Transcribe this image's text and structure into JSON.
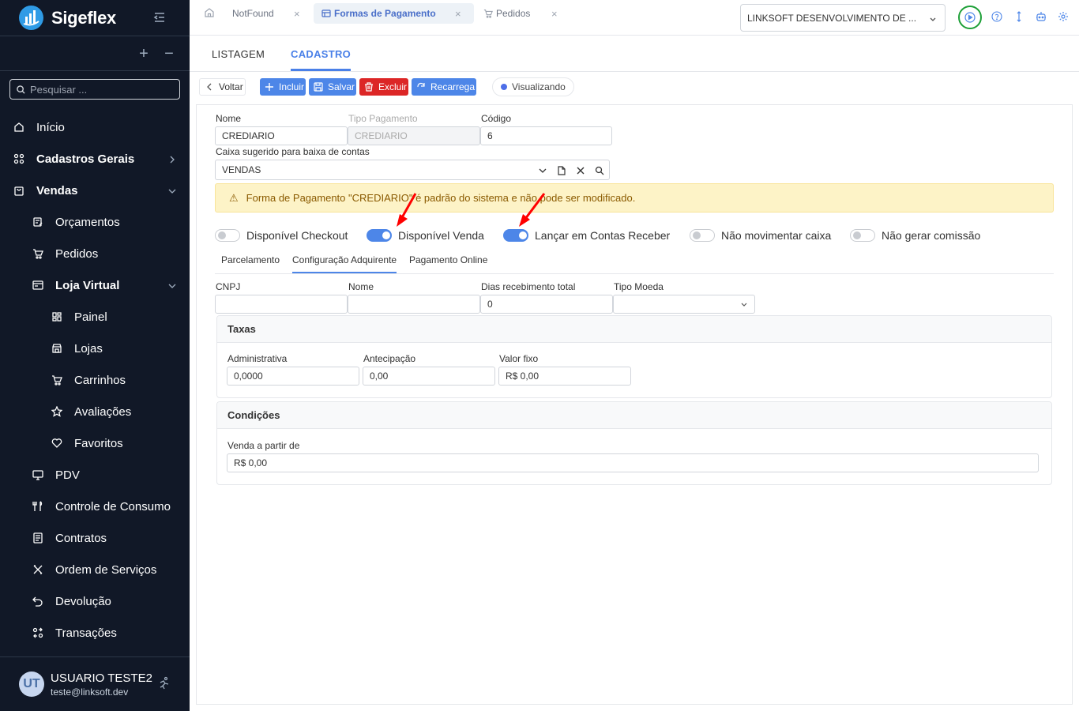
{
  "sidebar": {
    "brand": "Sigeflex",
    "search_placeholder": "Pesquisar ...",
    "plus": "+",
    "minus": "−",
    "items": [
      {
        "label": "Início"
      },
      {
        "label": "Cadastros Gerais"
      },
      {
        "label": "Vendas"
      },
      {
        "label": "Orçamentos"
      },
      {
        "label": "Pedidos"
      },
      {
        "label": "Loja Virtual"
      },
      {
        "label": "Painel"
      },
      {
        "label": "Lojas"
      },
      {
        "label": "Carrinhos"
      },
      {
        "label": "Avaliações"
      },
      {
        "label": "Favoritos"
      },
      {
        "label": "PDV"
      },
      {
        "label": "Controle de Consumo"
      },
      {
        "label": "Contratos"
      },
      {
        "label": "Ordem de Serviços"
      },
      {
        "label": "Devolução"
      },
      {
        "label": "Transações"
      }
    ],
    "user": {
      "initials": "UT",
      "name": "USUARIO TESTE2",
      "email": "teste@linksoft.dev"
    }
  },
  "topbar": {
    "tabs": [
      {
        "label": "NotFound"
      },
      {
        "label": "Formas de Pagamento"
      },
      {
        "label": "Pedidos"
      }
    ],
    "close_glyph": "×",
    "company": "LINKSOFT DESENVOLVIMENTO DE ..."
  },
  "content_tabs": {
    "list": "LISTAGEM",
    "form": "CADASTRO"
  },
  "toolbar": {
    "back": "Voltar",
    "add": "Incluir",
    "save": "Salvar",
    "delete": "Excluir",
    "reload": "Recarrega",
    "status": "Visualizando"
  },
  "form": {
    "nome_label": "Nome",
    "nome_value": "CREDIARIO",
    "tipo_label": "Tipo Pagamento",
    "tipo_value": "CREDIARIO",
    "codigo_label": "Código",
    "codigo_value": "6",
    "caixa_label": "Caixa sugerido para baixa de contas",
    "caixa_value": "VENDAS",
    "alert": "Forma de Pagamento \"CREDIARIO\" é padrão do sistema e não pode ser modificado.",
    "alert_icon": "⚠",
    "toggles": [
      {
        "label": "Disponível Checkout",
        "on": false
      },
      {
        "label": "Disponível Venda",
        "on": true
      },
      {
        "label": "Lançar em Contas Receber",
        "on": true
      },
      {
        "label": "Não movimentar caixa",
        "on": false
      },
      {
        "label": "Não gerar comissão",
        "on": false
      }
    ],
    "subtabs": [
      "Parcelamento",
      "Configuração Adquirente",
      "Pagamento Online"
    ],
    "adquirente": {
      "cnpj_label": "CNPJ",
      "cnpj_value": "",
      "nome_label": "Nome",
      "nome_value": "",
      "dias_label": "Dias recebimento total",
      "dias_value": "0",
      "moeda_label": "Tipo Moeda",
      "moeda_value": ""
    },
    "taxas": {
      "title": "Taxas",
      "admin_label": "Administrativa",
      "admin_value": "0,0000",
      "antecip_label": "Antecipação",
      "antecip_value": "0,00",
      "fixo_label": "Valor fixo",
      "fixo_value": "R$ 0,00"
    },
    "condicoes": {
      "title": "Condições",
      "venda_label": "Venda a partir de",
      "venda_value": "R$ 0,00"
    }
  },
  "colors": {
    "accent": "#4d86e8",
    "danger": "#dc2626",
    "sidebar": "#111827",
    "alert_bg": "#fdf3c7",
    "highlight_ring": "#1ea038",
    "annotation_arrow": "#ff0000"
  }
}
